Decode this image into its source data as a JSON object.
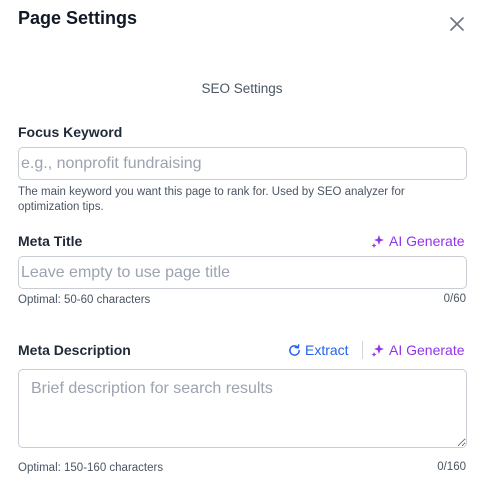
{
  "dialog": {
    "title": "Page Settings",
    "close_icon": "close-icon"
  },
  "section": {
    "heading": "SEO Settings"
  },
  "focus_keyword": {
    "label": "Focus Keyword",
    "value": "",
    "placeholder": "e.g., nonprofit fundraising",
    "help_line1": "The main keyword you want this page to rank for. Used by SEO analyzer for",
    "help_line2": "optimization tips."
  },
  "meta_title": {
    "label": "Meta Title",
    "ai_generate_label": "AI Generate",
    "value": "",
    "placeholder": "Leave empty to use page title",
    "hint": "Optimal: 50-60 characters",
    "counter": "0/60"
  },
  "meta_description": {
    "label": "Meta Description",
    "extract_label": "Extract",
    "ai_generate_label": "AI Generate",
    "value": "",
    "placeholder": "Brief description for search results",
    "hint": "Optimal: 150-160 characters",
    "counter": "0/160"
  },
  "colors": {
    "ai_accent": "#9333ea",
    "link_accent": "#2563eb",
    "border": "#c9cdd3",
    "text": "#1f2937"
  }
}
